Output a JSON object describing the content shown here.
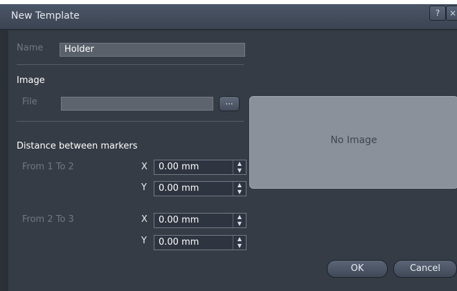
{
  "window": {
    "title": "New Template",
    "help_label": "?",
    "close_label": "×"
  },
  "name": {
    "label": "Name",
    "value": "Holder"
  },
  "image": {
    "heading": "Image",
    "file_label": "File",
    "file_value": "",
    "browse_label": "...",
    "preview_text": "No Image"
  },
  "distance": {
    "heading": "Distance between markers",
    "from12": {
      "label": "From 1 To 2",
      "x_label": "X",
      "y_label": "Y",
      "x_value": "0.00 mm",
      "y_value": "0.00 mm"
    },
    "from23": {
      "label": "From 2 To 3",
      "x_label": "X",
      "y_label": "Y",
      "x_value": "0.00 mm",
      "y_value": "0.00 mm"
    }
  },
  "buttons": {
    "ok": "OK",
    "cancel": "Cancel"
  },
  "colors": {
    "background": "#363c45",
    "titlebar": "#3b4452",
    "field": "#59606a",
    "preview": "#8a919b"
  }
}
